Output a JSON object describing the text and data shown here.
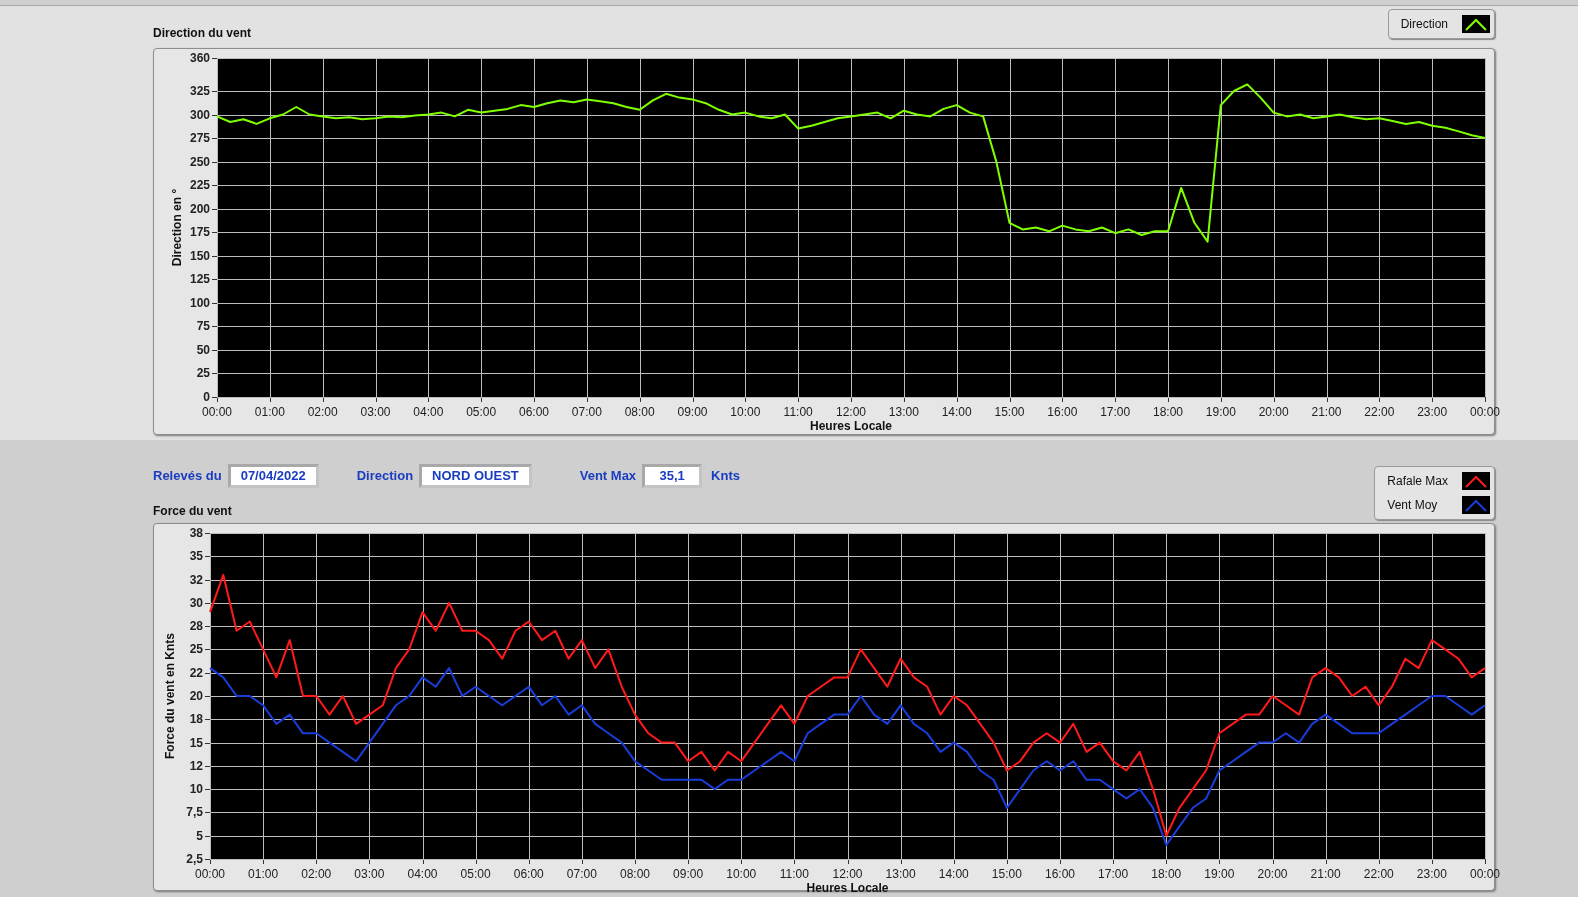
{
  "direction_chart": {
    "chart_data": {
      "type": "line",
      "title": "Direction du vent",
      "xlabel": "Heures Locale",
      "ylabel": "Direction en °",
      "x": [
        0,
        0.25,
        0.5,
        0.75,
        1,
        1.25,
        1.5,
        1.75,
        2,
        2.25,
        2.5,
        2.75,
        3,
        3.25,
        3.5,
        3.75,
        4,
        4.25,
        4.5,
        4.75,
        5,
        5.25,
        5.5,
        5.75,
        6,
        6.25,
        6.5,
        6.75,
        7,
        7.25,
        7.5,
        7.75,
        8,
        8.25,
        8.5,
        8.75,
        9,
        9.25,
        9.5,
        9.75,
        10,
        10.25,
        10.5,
        10.75,
        11,
        11.25,
        11.5,
        11.75,
        12,
        12.25,
        12.5,
        12.75,
        13,
        13.25,
        13.5,
        13.75,
        14,
        14.25,
        14.5,
        14.75,
        15,
        15.25,
        15.5,
        15.75,
        16,
        16.25,
        16.5,
        16.75,
        17,
        17.25,
        17.5,
        17.75,
        18,
        18.25,
        18.5,
        18.75,
        19,
        19.25,
        19.5,
        19.75,
        20,
        20.25,
        20.5,
        20.75,
        21,
        21.25,
        21.5,
        21.75,
        22,
        22.25,
        22.5,
        22.75,
        23,
        23.25,
        23.5,
        23.75,
        24
      ],
      "series": [
        {
          "name": "Direction",
          "color": "#80ff00",
          "values": [
            298,
            292,
            295,
            290,
            296,
            300,
            308,
            300,
            298,
            296,
            297,
            295,
            296,
            298,
            297,
            299,
            300,
            302,
            298,
            305,
            302,
            304,
            306,
            310,
            308,
            312,
            315,
            313,
            316,
            314,
            312,
            308,
            305,
            315,
            322,
            318,
            316,
            312,
            305,
            300,
            302,
            298,
            296,
            300,
            285,
            288,
            292,
            296,
            298,
            300,
            302,
            296,
            304,
            300,
            298,
            306,
            310,
            302,
            298,
            250,
            185,
            178,
            180,
            176,
            182,
            178,
            176,
            180,
            174,
            178,
            172,
            176,
            176,
            222,
            185,
            165,
            310,
            325,
            332,
            318,
            302,
            298,
            300,
            296,
            298,
            300,
            297,
            295,
            296,
            293,
            290,
            292,
            288,
            286,
            282,
            278,
            275
          ]
        }
      ],
      "xlim": [
        0,
        24
      ],
      "ylim": [
        0,
        360
      ],
      "xticks": [
        {
          "value": 0,
          "label": "00:00"
        },
        {
          "value": 1,
          "label": "01:00"
        },
        {
          "value": 2,
          "label": "02:00"
        },
        {
          "value": 3,
          "label": "03:00"
        },
        {
          "value": 4,
          "label": "04:00"
        },
        {
          "value": 5,
          "label": "05:00"
        },
        {
          "value": 6,
          "label": "06:00"
        },
        {
          "value": 7,
          "label": "07:00"
        },
        {
          "value": 8,
          "label": "08:00"
        },
        {
          "value": 9,
          "label": "09:00"
        },
        {
          "value": 10,
          "label": "10:00"
        },
        {
          "value": 11,
          "label": "11:00"
        },
        {
          "value": 12,
          "label": "12:00"
        },
        {
          "value": 13,
          "label": "13:00"
        },
        {
          "value": 14,
          "label": "14:00"
        },
        {
          "value": 15,
          "label": "15:00"
        },
        {
          "value": 16,
          "label": "16:00"
        },
        {
          "value": 17,
          "label": "17:00"
        },
        {
          "value": 18,
          "label": "18:00"
        },
        {
          "value": 19,
          "label": "19:00"
        },
        {
          "value": 20,
          "label": "20:00"
        },
        {
          "value": 21,
          "label": "21:00"
        },
        {
          "value": 22,
          "label": "22:00"
        },
        {
          "value": 23,
          "label": "23:00"
        },
        {
          "value": 24,
          "label": "00:00"
        }
      ],
      "yticks": [
        0,
        25,
        50,
        75,
        100,
        125,
        150,
        175,
        200,
        225,
        250,
        275,
        300,
        325,
        360
      ],
      "grid": true
    }
  },
  "readings": [
    {
      "label": "Relevés du",
      "value": "07/04/2022"
    },
    {
      "label": "Direction",
      "value": "NORD OUEST"
    },
    {
      "label": "Vent Max",
      "value": "35,1",
      "unit": "Knts"
    }
  ],
  "force_chart": {
    "chart_data": {
      "type": "line",
      "title": "Force du vent",
      "xlabel": "Heures Locale",
      "ylabel": "Force du vent en Knts",
      "x": [
        0,
        0.25,
        0.5,
        0.75,
        1,
        1.25,
        1.5,
        1.75,
        2,
        2.25,
        2.5,
        2.75,
        3,
        3.25,
        3.5,
        3.75,
        4,
        4.25,
        4.5,
        4.75,
        5,
        5.25,
        5.5,
        5.75,
        6,
        6.25,
        6.5,
        6.75,
        7,
        7.25,
        7.5,
        7.75,
        8,
        8.25,
        8.5,
        8.75,
        9,
        9.25,
        9.5,
        9.75,
        10,
        10.25,
        10.5,
        10.75,
        11,
        11.25,
        11.5,
        11.75,
        12,
        12.25,
        12.5,
        12.75,
        13,
        13.25,
        13.5,
        13.75,
        14,
        14.25,
        14.5,
        14.75,
        15,
        15.25,
        15.5,
        15.75,
        16,
        16.25,
        16.5,
        16.75,
        17,
        17.25,
        17.5,
        17.75,
        18,
        18.25,
        18.5,
        18.75,
        19,
        19.25,
        19.5,
        19.75,
        20,
        20.25,
        20.5,
        20.75,
        21,
        21.25,
        21.5,
        21.75,
        22,
        22.25,
        22.5,
        22.75,
        23,
        23.25,
        23.5,
        23.75,
        24
      ],
      "series": [
        {
          "name": "Rafale Max",
          "color": "#ff1a1a",
          "values": [
            29,
            33,
            27,
            28,
            25,
            22,
            26,
            20,
            20,
            18,
            20,
            17,
            18,
            19,
            23,
            25,
            29,
            27,
            30,
            27,
            27,
            26,
            24,
            27,
            28,
            26,
            27,
            24,
            26,
            23,
            25,
            21,
            18,
            16,
            15,
            15,
            13,
            14,
            12,
            14,
            13,
            15,
            17,
            19,
            17,
            20,
            21,
            22,
            22,
            25,
            23,
            21,
            24,
            22,
            21,
            18,
            20,
            19,
            17,
            15,
            12,
            13,
            15,
            16,
            15,
            17,
            14,
            15,
            13,
            12,
            14,
            10,
            5,
            8,
            10,
            12,
            16,
            17,
            18,
            18,
            20,
            19,
            18,
            22,
            23,
            22,
            20,
            21,
            19,
            21,
            24,
            23,
            26,
            25,
            24,
            22,
            23
          ]
        },
        {
          "name": "Vent Moy",
          "color": "#1a3cd8",
          "values": [
            23,
            22,
            20,
            20,
            19,
            17,
            18,
            16,
            16,
            15,
            14,
            13,
            15,
            17,
            19,
            20,
            22,
            21,
            23,
            20,
            21,
            20,
            19,
            20,
            21,
            19,
            20,
            18,
            19,
            17,
            16,
            15,
            13,
            12,
            11,
            11,
            11,
            11,
            10,
            11,
            11,
            12,
            13,
            14,
            13,
            16,
            17,
            18,
            18,
            20,
            18,
            17,
            19,
            17,
            16,
            14,
            15,
            14,
            12,
            11,
            8,
            10,
            12,
            13,
            12,
            13,
            11,
            11,
            10,
            9,
            10,
            8,
            4,
            6,
            8,
            9,
            12,
            13,
            14,
            15,
            15,
            16,
            15,
            17,
            18,
            17,
            16,
            16,
            16,
            17,
            18,
            19,
            20,
            20,
            19,
            18,
            19
          ]
        }
      ],
      "xlim": [
        0,
        24
      ],
      "ylim": [
        2.5,
        37.5
      ],
      "xticks": [
        {
          "value": 0,
          "label": "00:00"
        },
        {
          "value": 1,
          "label": "01:00"
        },
        {
          "value": 2,
          "label": "02:00"
        },
        {
          "value": 3,
          "label": "03:00"
        },
        {
          "value": 4,
          "label": "04:00"
        },
        {
          "value": 5,
          "label": "05:00"
        },
        {
          "value": 6,
          "label": "06:00"
        },
        {
          "value": 7,
          "label": "07:00"
        },
        {
          "value": 8,
          "label": "08:00"
        },
        {
          "value": 9,
          "label": "09:00"
        },
        {
          "value": 10,
          "label": "10:00"
        },
        {
          "value": 11,
          "label": "11:00"
        },
        {
          "value": 12,
          "label": "12:00"
        },
        {
          "value": 13,
          "label": "13:00"
        },
        {
          "value": 14,
          "label": "14:00"
        },
        {
          "value": 15,
          "label": "15:00"
        },
        {
          "value": 16,
          "label": "16:00"
        },
        {
          "value": 17,
          "label": "17:00"
        },
        {
          "value": 18,
          "label": "18:00"
        },
        {
          "value": 19,
          "label": "19:00"
        },
        {
          "value": 20,
          "label": "20:00"
        },
        {
          "value": 21,
          "label": "21:00"
        },
        {
          "value": 22,
          "label": "22:00"
        },
        {
          "value": 23,
          "label": "23:00"
        },
        {
          "value": 24,
          "label": "00:00"
        }
      ],
      "yticks": [
        {
          "value": 2.5,
          "label": "2,5"
        },
        5,
        {
          "value": 7.5,
          "label": "7,5"
        },
        10,
        {
          "value": 12.5,
          "label": "12"
        },
        15,
        {
          "value": 17.5,
          "label": "18"
        },
        20,
        {
          "value": 22.5,
          "label": "22"
        },
        25,
        {
          "value": 27.5,
          "label": "28"
        },
        30,
        {
          "value": 32.5,
          "label": "32"
        },
        35,
        {
          "value": 37.5,
          "label": "38"
        }
      ],
      "grid": true
    }
  }
}
